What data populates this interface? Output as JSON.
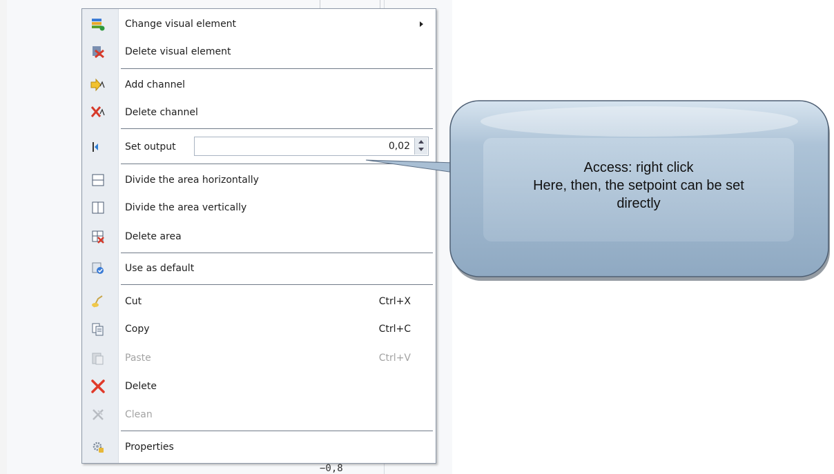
{
  "background": {
    "axis_tick_label": "−0,8"
  },
  "menu": {
    "items": [
      {
        "label": "Change visual element",
        "icon": "change-element-icon",
        "has_submenu": true
      },
      {
        "label": "Delete visual element",
        "icon": "delete-element-icon"
      },
      {
        "label": "Add channel",
        "icon": "add-channel-icon"
      },
      {
        "label": "Delete channel",
        "icon": "delete-channel-icon"
      },
      {
        "label": "Set output",
        "icon": "set-output-icon",
        "value": "0,02"
      },
      {
        "label": "Divide the area horizontally",
        "icon": "divide-horizontal-icon"
      },
      {
        "label": "Divide the area vertically",
        "icon": "divide-vertical-icon"
      },
      {
        "label": "Delete area",
        "icon": "delete-area-icon"
      },
      {
        "label": "Use as default",
        "icon": "use-default-icon"
      },
      {
        "label": "Cut",
        "icon": "cut-icon",
        "shortcut": "Ctrl+X"
      },
      {
        "label": "Copy",
        "icon": "copy-icon",
        "shortcut": "Ctrl+C"
      },
      {
        "label": "Paste",
        "icon": "paste-icon",
        "shortcut": "Ctrl+V",
        "disabled": true
      },
      {
        "label": "Delete",
        "icon": "delete-icon"
      },
      {
        "label": "Clean",
        "icon": "clean-icon",
        "disabled": true
      },
      {
        "label": "Properties",
        "icon": "properties-icon"
      }
    ]
  },
  "callout": {
    "line1": "Access: right click",
    "line2": "Here, then, the setpoint can be set",
    "line3": "directly"
  },
  "colors": {
    "menu_border": "#8e99a8",
    "gutter": "#e9edf2",
    "delete_red": "#e03a2a",
    "callout_body": "#a9bfd4"
  }
}
